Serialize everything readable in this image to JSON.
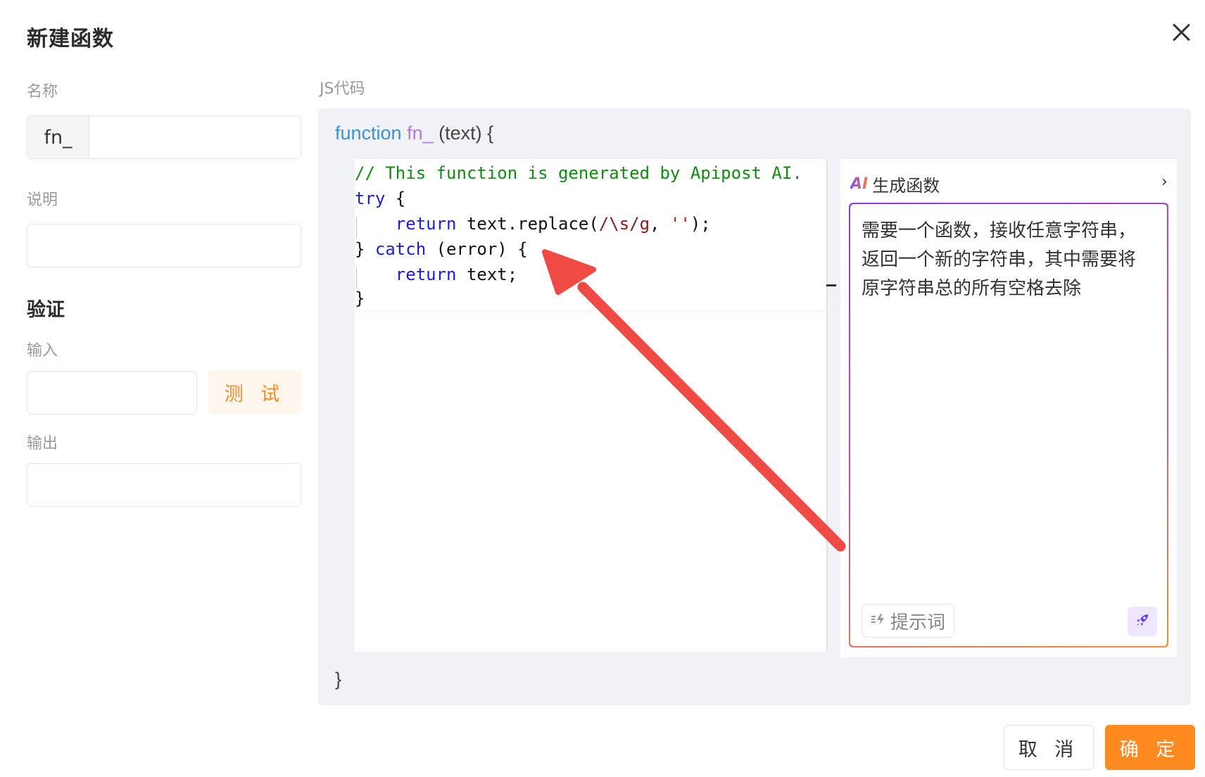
{
  "dialog": {
    "title": "新建函数",
    "close_icon": "close-icon"
  },
  "form": {
    "name_label": "名称",
    "name_prefix": "fn_",
    "name_value": "",
    "desc_label": "说明",
    "desc_value": "",
    "validate_title": "验证",
    "input_label": "输入",
    "input_value": "",
    "test_button": "测 试",
    "output_label": "输出",
    "output_value": ""
  },
  "code": {
    "label": "JS代码",
    "sig_keyword": "function",
    "sig_name": "fn_",
    "sig_params": " (text) {",
    "closing_brace": "}",
    "lines": {
      "l1": "// This function is generated by Apipost AI.",
      "l2_kw": "try",
      "l2_rest": " {",
      "l3_kw": "return",
      "l3_a": " text.replace(",
      "l3_re": "/\\s/g",
      "l3_b": ", ",
      "l3_str": "''",
      "l3_c": ");",
      "l4_a": "} ",
      "l4_kw": "catch",
      "l4_b": " (error) {",
      "l5_kw": "return",
      "l5_rest": " text;",
      "l6": "}"
    }
  },
  "ai": {
    "logo": "AI",
    "title": "生成函数",
    "chevron": "›",
    "prompt_text": "需要一个函数，接收任意字符串，返回一个新的字符串，其中需要将原字符串总的所有空格去除",
    "hint_button": "提示词",
    "hint_icon": "lightning-icon",
    "send_icon": "rocket-icon"
  },
  "footer": {
    "cancel": "取 消",
    "confirm": "确 定"
  },
  "colors": {
    "accent": "#ff8a1f",
    "annotation_arrow": "#f04a45"
  }
}
